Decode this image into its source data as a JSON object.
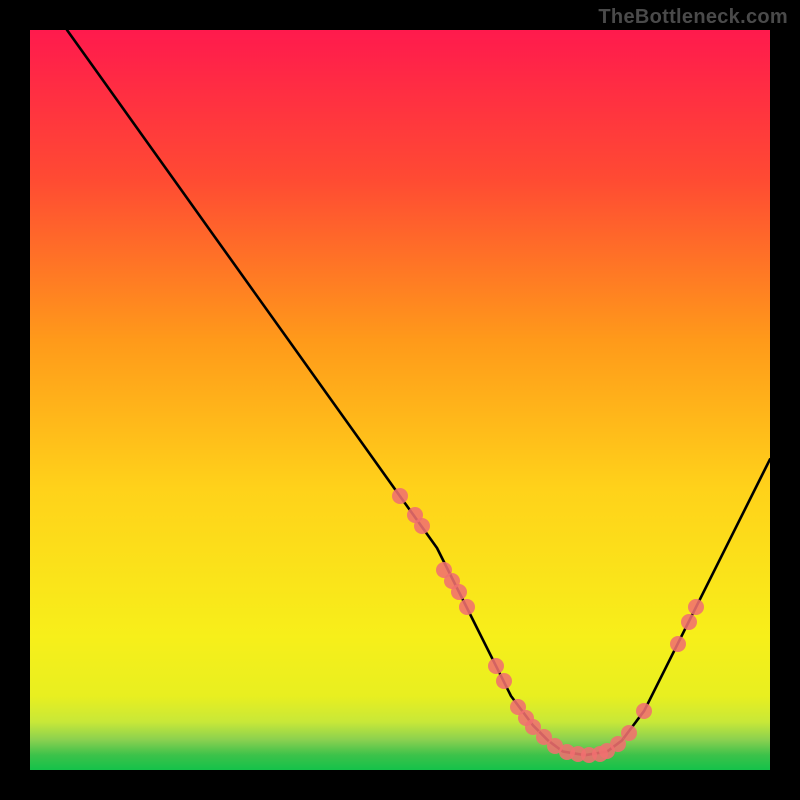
{
  "watermark": "TheBottleneck.com",
  "gradient_colors": {
    "top": "#ff1a4d",
    "mid1": "#ff6a2a",
    "mid2": "#ffd21a",
    "low": "#f7ef1a",
    "band1": "#d7ef30",
    "band2": "#8ed050",
    "bottom": "#14c24a"
  },
  "curve_color": "#000000",
  "marker_color": "#f07070",
  "chart_data": {
    "type": "line",
    "title": "",
    "xlabel": "",
    "ylabel": "",
    "xlim": [
      0,
      100
    ],
    "ylim": [
      0,
      100
    ],
    "grid": false,
    "series": [
      {
        "name": "bottleneck-curve",
        "x": [
          5,
          10,
          15,
          20,
          25,
          30,
          35,
          40,
          45,
          50,
          55,
          60,
          62,
          65,
          68,
          70,
          72,
          75,
          78,
          80,
          83,
          86,
          90,
          95,
          100
        ],
        "y": [
          100,
          93,
          86,
          79,
          72,
          65,
          58,
          51,
          44,
          37,
          30,
          20,
          16,
          10,
          6,
          4,
          2.5,
          2,
          2.5,
          4,
          8,
          14,
          22,
          32,
          42
        ]
      }
    ],
    "markers": [
      {
        "x": 50,
        "y": 37
      },
      {
        "x": 52,
        "y": 34.5
      },
      {
        "x": 53,
        "y": 33
      },
      {
        "x": 56,
        "y": 27
      },
      {
        "x": 57,
        "y": 25.5
      },
      {
        "x": 58,
        "y": 24
      },
      {
        "x": 59,
        "y": 22
      },
      {
        "x": 63,
        "y": 14
      },
      {
        "x": 64,
        "y": 12
      },
      {
        "x": 66,
        "y": 8.5
      },
      {
        "x": 67,
        "y": 7
      },
      {
        "x": 68,
        "y": 5.8
      },
      {
        "x": 69.5,
        "y": 4.5
      },
      {
        "x": 71,
        "y": 3.2
      },
      {
        "x": 72.5,
        "y": 2.5
      },
      {
        "x": 74,
        "y": 2.1
      },
      {
        "x": 75.5,
        "y": 2
      },
      {
        "x": 77,
        "y": 2.2
      },
      {
        "x": 78,
        "y": 2.6
      },
      {
        "x": 79.5,
        "y": 3.5
      },
      {
        "x": 81,
        "y": 5
      },
      {
        "x": 83,
        "y": 8
      },
      {
        "x": 87.5,
        "y": 17
      },
      {
        "x": 89,
        "y": 20
      },
      {
        "x": 90,
        "y": 22
      }
    ]
  }
}
